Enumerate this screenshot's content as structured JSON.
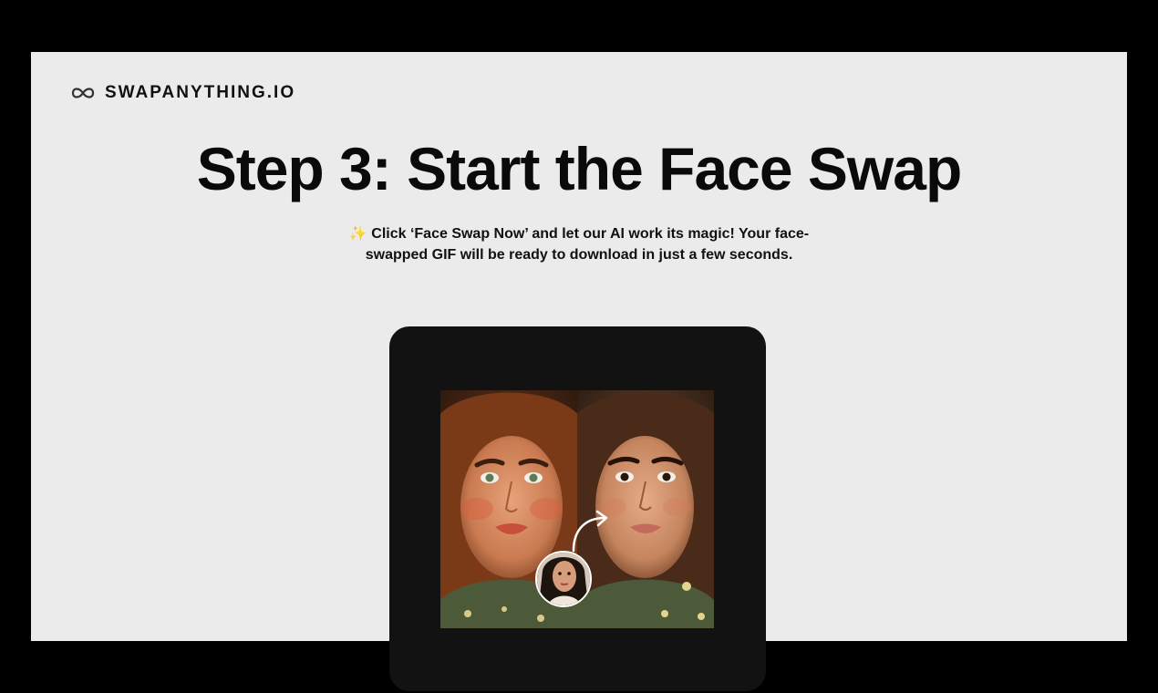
{
  "brand": {
    "logo_icon": "infinity-icon",
    "name": "SWAPANYTHING.IO"
  },
  "hero": {
    "title": "Step 3: Start the Face Swap",
    "sparkle_emoji": "✨",
    "subtitle": "Click ‘Face Swap Now’ and let our AI work its magic! Your face-swapped GIF will be ready to download in just a few seconds."
  },
  "preview": {
    "before_label": "original-face",
    "after_label": "swapped-face",
    "arrow_icon": "curved-arrow-icon",
    "source_avatar": "source-face-avatar"
  },
  "colors": {
    "background": "#000000",
    "slide": "#ebebeb",
    "card": "#121212",
    "text": "#0a0a0a"
  }
}
